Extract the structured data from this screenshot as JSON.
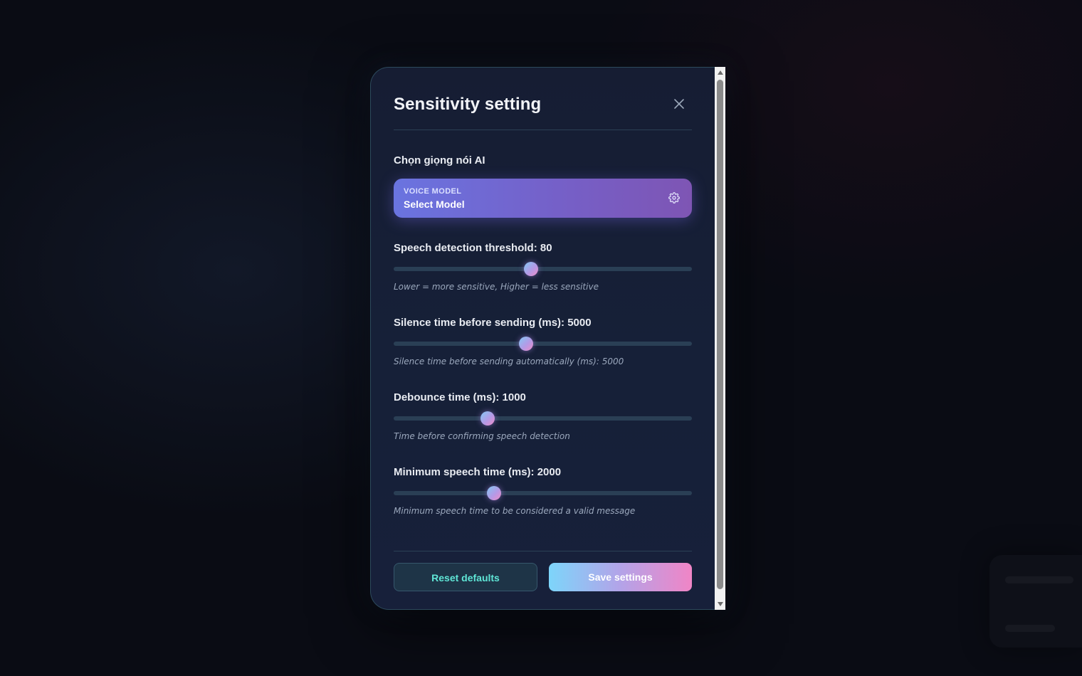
{
  "modal": {
    "title": "Sensitivity setting",
    "close_icon": "close-icon"
  },
  "voice": {
    "section_label": "Chọn giọng nói AI",
    "caption": "VOICE MODEL",
    "value": "Select Model",
    "icon": "gear-icon"
  },
  "sliders": {
    "threshold": {
      "label": "Speech detection threshold: 80",
      "hint": "Lower = more sensitive, Higher = less sensitive",
      "level": 0.46
    },
    "silence": {
      "label": "Silence time before sending (ms): 5000",
      "hint": "Silence time before sending automatically (ms): 5000",
      "level": 0.445
    },
    "debounce": {
      "label": "Debounce time (ms): 1000",
      "hint": "Time before confirming speech detection",
      "level": 0.315
    },
    "min_speech": {
      "label": "Minimum speech time (ms): 2000",
      "hint": "Minimum speech time to be considered a valid message",
      "level": 0.337
    }
  },
  "footer": {
    "reset_label": "Reset defaults",
    "save_label": "Save settings"
  },
  "colors": {
    "accent_gradient_start": "#7dd5fa",
    "accent_gradient_end": "#f085c6",
    "voice_card_start": "#6a74e0",
    "voice_card_end": "#7e55b4",
    "reset_text": "#5fe6d6"
  }
}
